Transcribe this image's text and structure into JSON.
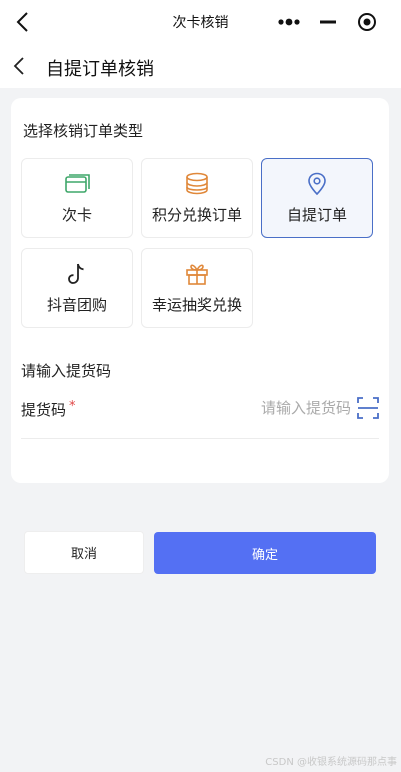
{
  "topbar": {
    "title": "次卡核销"
  },
  "navbar": {
    "title": "自提订单核销"
  },
  "order_type": {
    "label": "选择核销订单类型",
    "selected": "自提订单",
    "options": [
      {
        "label": "次卡",
        "icon": "card-icon"
      },
      {
        "label": "积分兑换订单",
        "icon": "coin-stack-icon"
      },
      {
        "label": "自提订单",
        "icon": "location-pin-icon"
      },
      {
        "label": "抖音团购",
        "icon": "tiktok-icon"
      },
      {
        "label": "幸运抽奖兑换",
        "icon": "gift-icon"
      }
    ]
  },
  "pickup": {
    "section_label": "请输入提货码",
    "field_label": "提货码",
    "required_mark": "*",
    "value": "",
    "placeholder": "请输入提货码"
  },
  "actions": {
    "cancel": "取消",
    "confirm": "确定"
  },
  "watermark": "CSDN @收银系统源码那点事",
  "colors": {
    "primary": "#5470f3",
    "selected_border": "#4a6fc7",
    "required": "#e04545",
    "card_icon": "#3fa76a",
    "coin_icon": "#e0883a",
    "pin_icon": "#4a6fc7",
    "gift_icon": "#e0883a"
  }
}
